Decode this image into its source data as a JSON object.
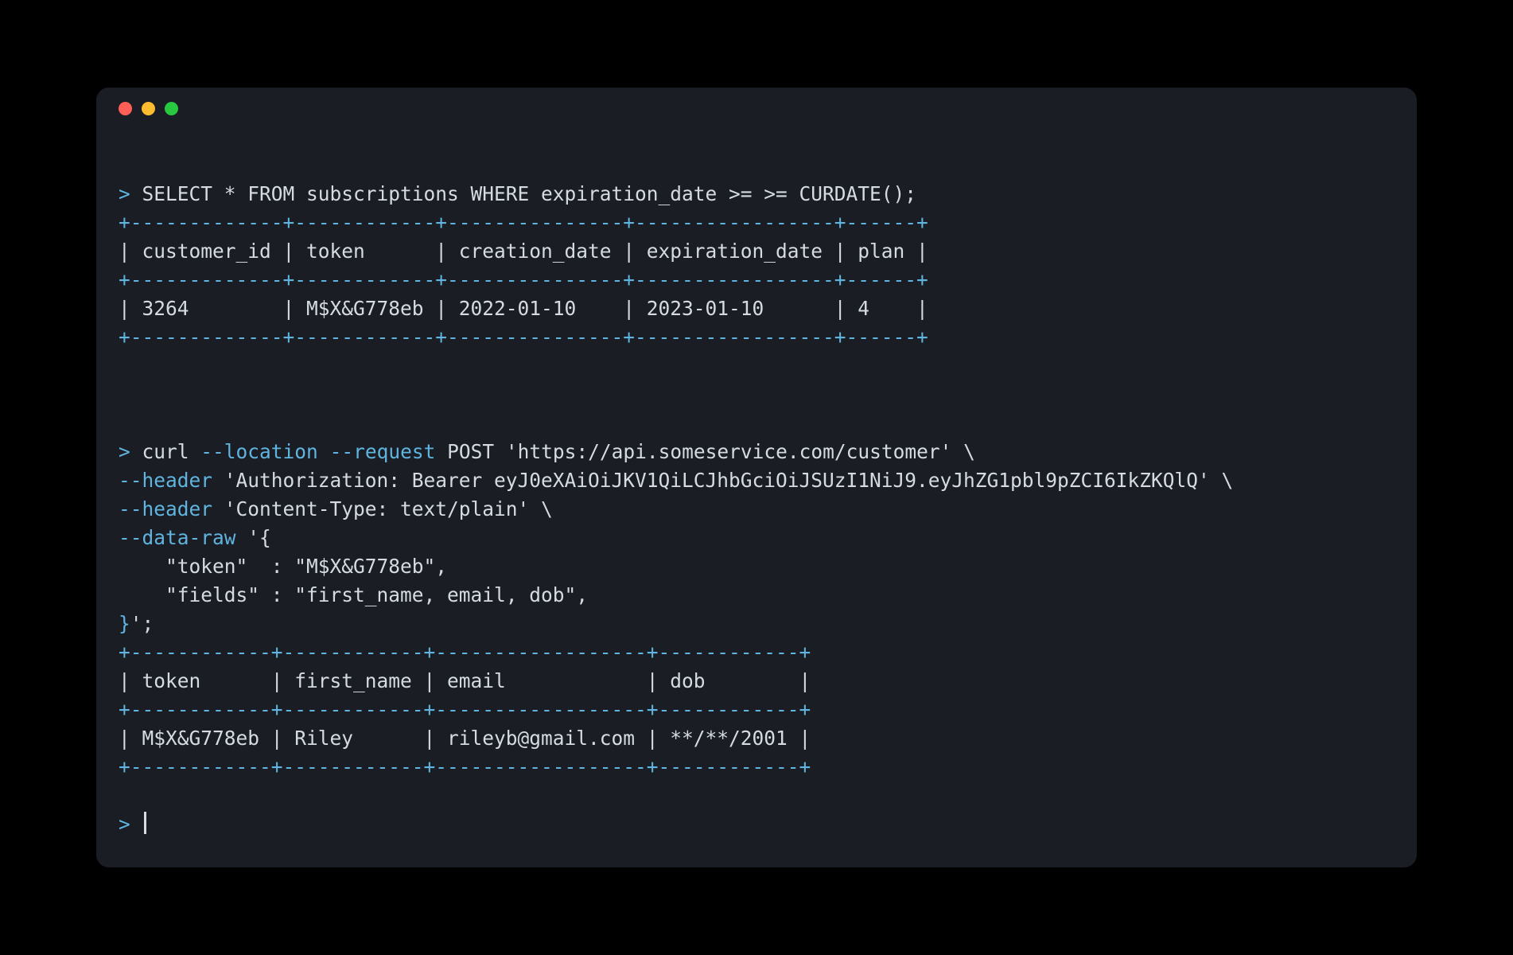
{
  "block1": {
    "prompt": ">",
    "cmd": "SELECT * FROM subscriptions WHERE expiration_date >= >= CURDATE();",
    "border_top": "+-------------+------------+---------------+-----------------+------+",
    "header_row": "| customer_id | token      | creation_date | expiration_date | plan |",
    "border_mid": "+-------------+------------+---------------+-----------------+------+",
    "data_row": "| 3264        | M$X&G778eb | 2022-01-10    | 2023-01-10      | 4    |",
    "border_bot": "+-------------+------------+---------------+-----------------+------+"
  },
  "block2": {
    "prompt": ">",
    "cmd_l1_a": "curl ",
    "cmd_l1_flag1": "--location",
    "cmd_l1_b": " ",
    "cmd_l1_flag2": "--request",
    "cmd_l1_c": " POST 'https://api.someservice.com/customer' \\",
    "cmd_l2_flag": "--header",
    "cmd_l2_rest": " 'Authorization: Bearer eyJ0eXAiOiJKV1QiLCJhbGciOiJSUzI1NiJ9.eyJhZG1pbl9pZCI6IkZKQlQ' \\",
    "cmd_l3_flag": "--header",
    "cmd_l3_rest": " 'Content-Type: text/plain' \\",
    "cmd_l4_flag": "--data-raw",
    "cmd_l4_rest": " '{",
    "cmd_l5": "    \"token\"  : \"M$X&G778eb\",",
    "cmd_l6": "    \"fields\" : \"first_name, email, dob\",",
    "cmd_l7_brace": "}",
    "cmd_l7_rest": "';",
    "border_top": "+------------+------------+------------------+------------+",
    "header_row": "| token      | first_name | email            | dob        |",
    "border_mid": "+------------+------------+------------------+------------+",
    "data_row": "| M$X&G778eb | Riley      | rileyb@gmail.com | **/**/2001 |",
    "border_bot": "+------------+------------+------------------+------------+"
  },
  "block3": {
    "prompt": ">"
  }
}
